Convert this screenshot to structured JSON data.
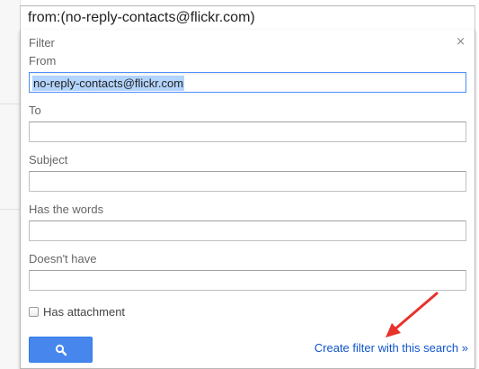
{
  "search": {
    "query": "from:(no-reply-contacts@flickr.com)"
  },
  "filter_panel": {
    "title": "Filter",
    "close_glyph": "×",
    "fields": {
      "from": {
        "label": "From",
        "value": "no-reply-contacts@flickr.com"
      },
      "to": {
        "label": "To",
        "value": ""
      },
      "subject": {
        "label": "Subject",
        "value": ""
      },
      "has_words": {
        "label": "Has the words",
        "value": ""
      },
      "doesnt_have": {
        "label": "Doesn't have",
        "value": ""
      }
    },
    "has_attachment": {
      "label": "Has attachment",
      "checked": false
    },
    "search_button_icon": "search-icon",
    "create_filter_link": "Create filter with this search »"
  },
  "colors": {
    "accent_blue": "#4787ed",
    "link_blue": "#1155cc",
    "selection": "#b3d4fc",
    "annotation_arrow": "#e8322c"
  }
}
